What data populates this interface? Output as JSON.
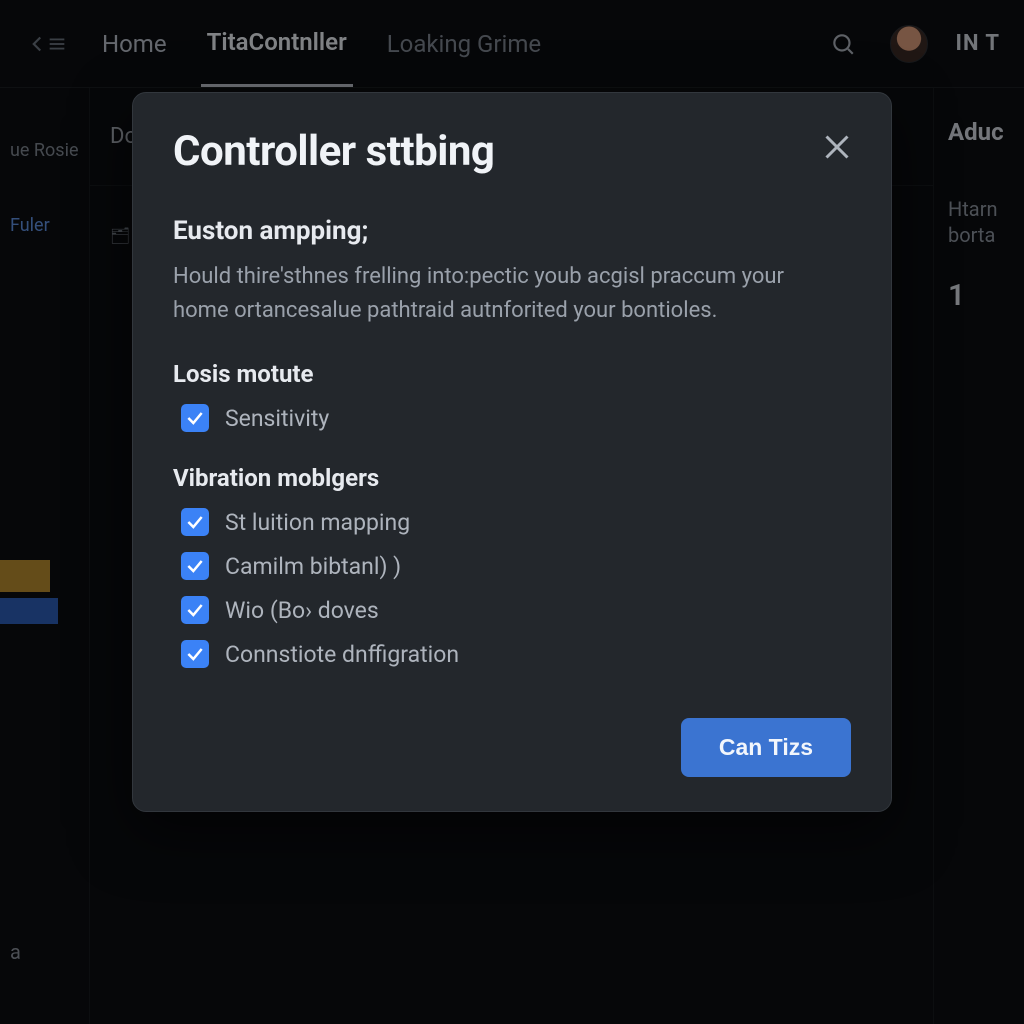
{
  "nav": {
    "home": "Home",
    "tab_active": "TitaContnller",
    "tab_2": "Loaking Grime",
    "user_label": "IN T"
  },
  "sidebar": {
    "item0": "ue Rosie",
    "item1": "Fuler",
    "letter": "a"
  },
  "mid": {
    "header": "Do",
    "row_icon_glyph": "🗂"
  },
  "right": {
    "header": "Aduc",
    "sub": "Htarn borta",
    "num": "1"
  },
  "modal": {
    "title": "Controller sttbing",
    "section1_title": "Euston ampping;",
    "section1_desc": "Hould thire'sthnes frelling into:pectic youb acgisl praccum your home ortancesalue pathtraid autnforited your bontioles.",
    "sub1": "Losis motute",
    "sub2": "Vibration moblgers",
    "checks": {
      "sensitivity": "Sensitivity",
      "v0": "St luition mapping",
      "v1": "Camilm bibtanl) )",
      "v2": "Wio (Bo› doves",
      "v3": "Connstiote dnffigration"
    },
    "confirm": "Can Tizs"
  }
}
